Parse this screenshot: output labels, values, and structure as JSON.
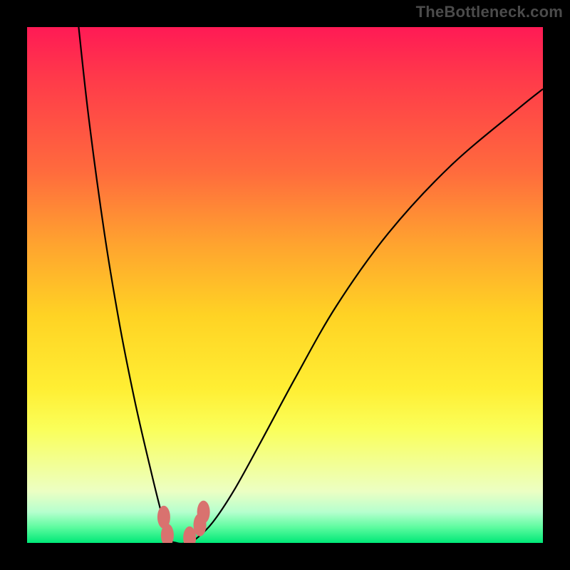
{
  "attribution": "TheBottleneck.com",
  "chart_data": {
    "type": "line",
    "title": "",
    "xlabel": "",
    "ylabel": "",
    "xlim": [
      0,
      100
    ],
    "ylim": [
      0,
      100
    ],
    "series": [
      {
        "name": "bottleneck-curve",
        "x": [
          10,
          12,
          15,
          18,
          21,
          24,
          26,
          27.5,
          29,
          31,
          33,
          36,
          40,
          45,
          52,
          60,
          70,
          82,
          95,
          100
        ],
        "y": [
          100,
          82,
          60,
          42,
          27,
          14,
          6,
          1,
          0,
          0,
          1,
          4,
          10,
          19,
          32,
          46,
          60,
          73,
          84,
          88
        ]
      }
    ],
    "annotations": [
      {
        "name": "blob-1",
        "x": 26.5,
        "y": 5
      },
      {
        "name": "blob-2",
        "x": 27.2,
        "y": 1.5
      },
      {
        "name": "blob-3",
        "x": 31.5,
        "y": 1.0
      },
      {
        "name": "blob-4",
        "x": 33.5,
        "y": 3.5
      },
      {
        "name": "blob-5",
        "x": 34.2,
        "y": 6.0
      }
    ]
  },
  "colors": {
    "curve": "#000000",
    "blob": "#d9726f",
    "frame": "#000000"
  }
}
